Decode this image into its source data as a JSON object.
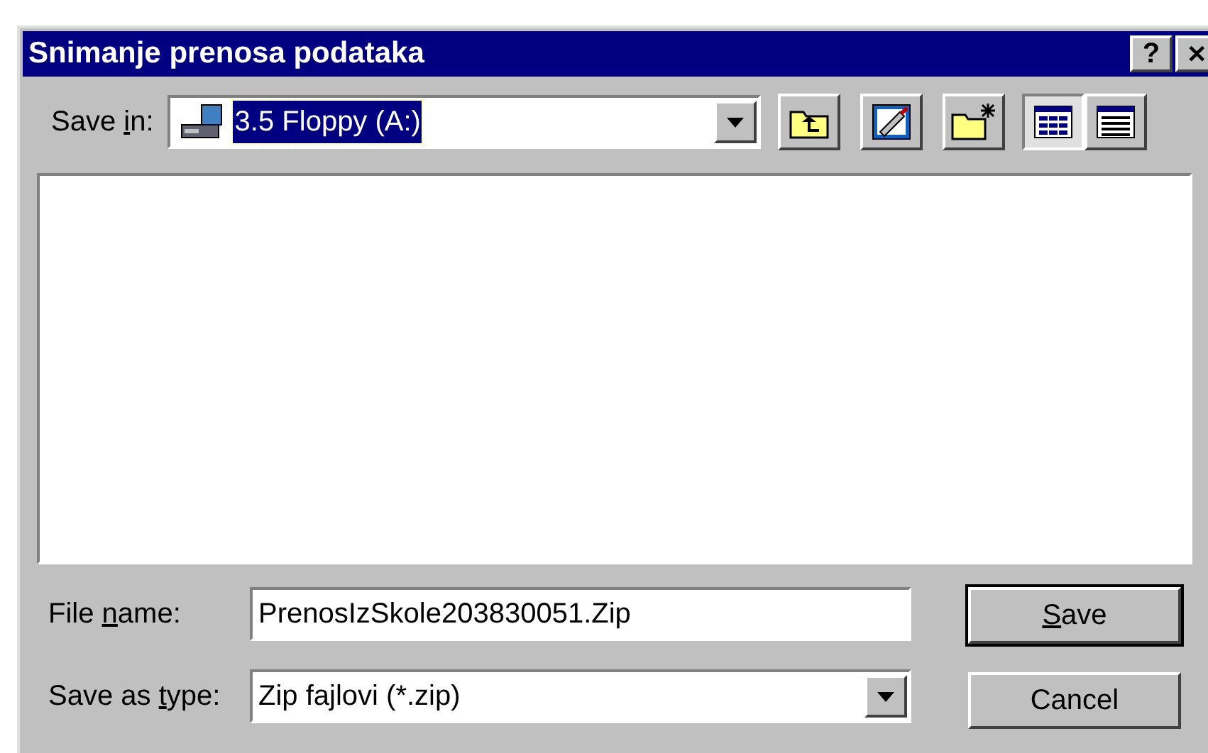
{
  "window": {
    "title": "Snimanje prenosa podataka",
    "buttons": [
      {
        "kind": "help",
        "label": "?"
      },
      {
        "kind": "close",
        "label": "✕"
      }
    ]
  },
  "save_in": {
    "label": {
      "before": "Save ",
      "key": "i",
      "after": "n:"
    },
    "value": "3.5 Floppy (A:)",
    "focused": true
  },
  "toolbar": [
    {
      "kind": "up-folder"
    },
    {
      "kind": "desktop"
    },
    {
      "kind": "new-folder"
    }
  ],
  "views": [
    {
      "kind": "list",
      "selected": true
    },
    {
      "kind": "details",
      "selected": false
    }
  ],
  "file_name": {
    "label": {
      "before": "File ",
      "key": "n",
      "after": "ame:"
    },
    "value": "PrenosIzSkole203830051.Zip"
  },
  "save_as_type": {
    "label": {
      "before": "Save as ",
      "key": "t",
      "after": "ype:"
    },
    "value": "Zip fajlovi (*.zip)"
  },
  "buttons": [
    {
      "label": {
        "key": "S",
        "after": "ave"
      },
      "default": true
    },
    {
      "label": {
        "before": "Cancel"
      },
      "default": false
    }
  ]
}
